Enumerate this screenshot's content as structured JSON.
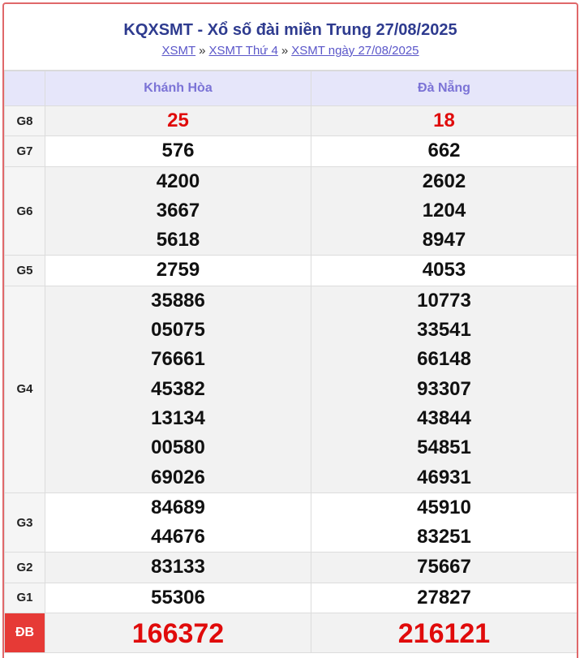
{
  "header": {
    "title": "KQXSMT - Xổ số đài miền Trung 27/08/2025",
    "breadcrumb": [
      {
        "label": "XSMT"
      },
      {
        "label": "XSMT Thứ 4"
      },
      {
        "label": "XSMT ngày 27/08/2025"
      }
    ],
    "separator": "»"
  },
  "provinces": [
    "Khánh Hòa",
    "Đà Nẵng"
  ],
  "prizes": [
    {
      "label": "G8",
      "cols": [
        [
          "25"
        ],
        [
          "18"
        ]
      ]
    },
    {
      "label": "G7",
      "cols": [
        [
          "576"
        ],
        [
          "662"
        ]
      ]
    },
    {
      "label": "G6",
      "cols": [
        [
          "4200",
          "3667",
          "5618"
        ],
        [
          "2602",
          "1204",
          "8947"
        ]
      ]
    },
    {
      "label": "G5",
      "cols": [
        [
          "2759"
        ],
        [
          "4053"
        ]
      ]
    },
    {
      "label": "G4",
      "cols": [
        [
          "35886",
          "05075",
          "76661",
          "45382",
          "13134",
          "00580",
          "69026"
        ],
        [
          "10773",
          "33541",
          "66148",
          "93307",
          "43844",
          "54851",
          "46931"
        ]
      ]
    },
    {
      "label": "G3",
      "cols": [
        [
          "84689",
          "44676"
        ],
        [
          "45910",
          "83251"
        ]
      ]
    },
    {
      "label": "G2",
      "cols": [
        [
          "83133"
        ],
        [
          "75667"
        ]
      ]
    },
    {
      "label": "G1",
      "cols": [
        [
          "55306"
        ],
        [
          "27827"
        ]
      ]
    },
    {
      "label": "ĐB",
      "cols": [
        [
          "166372"
        ],
        [
          "216121"
        ]
      ]
    }
  ],
  "colors": {
    "title": "#2e3b8f",
    "link": "#5a56c9",
    "header_bg": "#e6e6fa",
    "special_red": "#e00b0b",
    "db_label_bg": "#e63a36",
    "frame_border": "#e0686a"
  }
}
